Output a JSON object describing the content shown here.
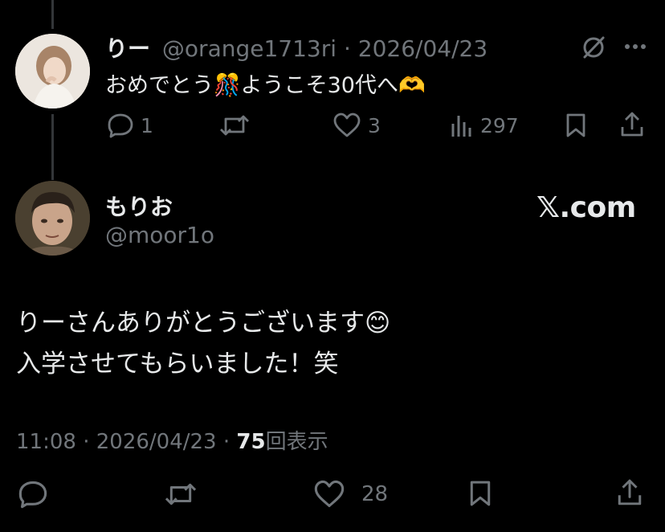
{
  "reply": {
    "display_name": "りー",
    "handle": "@orange1713ri",
    "separator": "·",
    "date": "2026/04/23",
    "text": "おめでとう🎊ようこそ30代へ🫶",
    "actions": {
      "replies": "1",
      "reposts": "",
      "likes": "3",
      "views": "297"
    }
  },
  "main": {
    "display_name": "もりお",
    "handle": "@moor1o",
    "brand": "𝕏.com",
    "text_line1": "りーさんありがとうございます😊",
    "text_line2": "入学させてもらいました！笑",
    "meta": {
      "time": "11:08",
      "separator1": "·",
      "date": "2026/04/23",
      "separator2": "·",
      "views_count": "75",
      "views_label": "回表示"
    },
    "actions": {
      "likes": "28"
    }
  },
  "colors": {
    "background": "#000000",
    "text": "#e7e9ea",
    "muted": "#71767b",
    "thread_line": "#333639"
  }
}
